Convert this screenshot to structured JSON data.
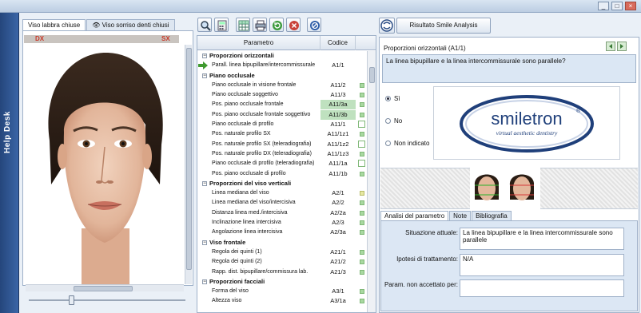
{
  "window": {
    "controls": [
      "minimize",
      "maximize",
      "close"
    ]
  },
  "helpdesk": {
    "label": "Help Desk"
  },
  "left_tabs": [
    {
      "label": "Viso labbra chiuse",
      "active": true
    },
    {
      "label": "Viso sorriso denti chiusi",
      "active": false
    }
  ],
  "photo": {
    "dx": "DX",
    "sx": "SX"
  },
  "toolbar": {
    "icons": [
      "zoom-icon",
      "calculator-icon",
      "grid-icon",
      "print-icon",
      "refresh-icon",
      "close-circle-icon",
      "stop-icon"
    ]
  },
  "table": {
    "header_param": "Parametro",
    "header_code": "Codice",
    "rows": [
      {
        "type": "section",
        "label": "Proporzioni orizzontali",
        "code": ""
      },
      {
        "type": "item",
        "label": "Parall. linea bipupillare/intercommissurale",
        "code": "A1/1",
        "mark": "none",
        "current": true
      },
      {
        "type": "section",
        "label": "Piano occlusale",
        "code": ""
      },
      {
        "type": "item",
        "label": "Piano occlusale in visione frontale",
        "code": "A11/2",
        "mark": "green"
      },
      {
        "type": "item",
        "label": "Piano occlusale soggettivo",
        "code": "A11/3",
        "mark": "green"
      },
      {
        "type": "item",
        "label": "Pos. piano occlusale frontale",
        "code": "A11/3a",
        "mark": "green",
        "highlight": true
      },
      {
        "type": "item",
        "label": "Pos. piano occlusale frontale soggettivo",
        "code": "A11/3b",
        "mark": "green",
        "highlight": true
      },
      {
        "type": "item",
        "label": "Piano occlusale di profilo",
        "code": "A11/1",
        "mark": "open"
      },
      {
        "type": "item",
        "label": "Pos. naturale profilo SX",
        "code": "A11/1z1",
        "mark": "green"
      },
      {
        "type": "item",
        "label": "Pos. naturale profilo SX (teleradiografia)",
        "code": "A11/1z2",
        "mark": "open"
      },
      {
        "type": "item",
        "label": "Pos. naturale profilo DX (teleradiografia)",
        "code": "A11/1z3",
        "mark": "green"
      },
      {
        "type": "item",
        "label": "Piano occlusale di profilo (teleradiografia)",
        "code": "A11/1a",
        "mark": "open"
      },
      {
        "type": "item",
        "label": "Pos. piano occlusale di profilo",
        "code": "A11/1b",
        "mark": "green"
      },
      {
        "type": "section",
        "label": "Proporzioni del viso verticali",
        "code": ""
      },
      {
        "type": "item",
        "label": "Linea mediana del viso",
        "code": "A2/1",
        "mark": "yellow"
      },
      {
        "type": "item",
        "label": "Linea mediana del viso/intercisiva",
        "code": "A2/2",
        "mark": "green"
      },
      {
        "type": "item",
        "label": "Distanza linea med./intercisiva",
        "code": "A2/2a",
        "mark": "green"
      },
      {
        "type": "item",
        "label": "Inclinazione linea intercisiva",
        "code": "A2/3",
        "mark": "green"
      },
      {
        "type": "item",
        "label": "Angolazione linea intercisiva",
        "code": "A2/3a",
        "mark": "green"
      },
      {
        "type": "section",
        "label": "Viso frontale",
        "code": ""
      },
      {
        "type": "item",
        "label": "Regola dei quinti (1)",
        "code": "A21/1",
        "mark": "green"
      },
      {
        "type": "item",
        "label": "Regola dei quinti (2)",
        "code": "A21/2",
        "mark": "green"
      },
      {
        "type": "item",
        "label": "Rapp. dist. bipupillare/commissura lab.",
        "code": "A21/3",
        "mark": "green"
      },
      {
        "type": "section",
        "label": "Proporzioni facciali",
        "code": ""
      },
      {
        "type": "item",
        "label": "Forma del viso",
        "code": "A3/1",
        "mark": "green"
      },
      {
        "type": "item",
        "label": "Altezza viso",
        "code": "A3/1a",
        "mark": "green"
      }
    ]
  },
  "right": {
    "result_button": "Risultato Smile Analysis",
    "question_title": "Proporzioni orizzontali (A1/1)",
    "question_text": "La linea bipupillare e la linea intercommissurale sono parallele?",
    "options": [
      {
        "label": "Sì",
        "selected": true
      },
      {
        "label": "No",
        "selected": false
      },
      {
        "label": "Non indicato",
        "selected": false
      }
    ],
    "logo": {
      "brand": "smiletron",
      "registered": "®",
      "tagline": "virtual aesthetic dentistry"
    },
    "tabs": [
      {
        "label": "Analisi del parametro",
        "active": true
      },
      {
        "label": "Note",
        "active": false
      },
      {
        "label": "Bibliografia",
        "active": false
      }
    ],
    "fields": [
      {
        "label": "Situazione attuale:",
        "value": "La linea bipupillare e la linea intercommissurale sono parallele"
      },
      {
        "label": "Ipotesi di trattamento:",
        "value": "N/A"
      },
      {
        "label": "Param. non accettato per:",
        "value": ""
      }
    ]
  },
  "colors": {
    "accent": "#3a65a6",
    "highlight_green": "#bfe1bf",
    "side_label_red": "#c83a2a"
  }
}
